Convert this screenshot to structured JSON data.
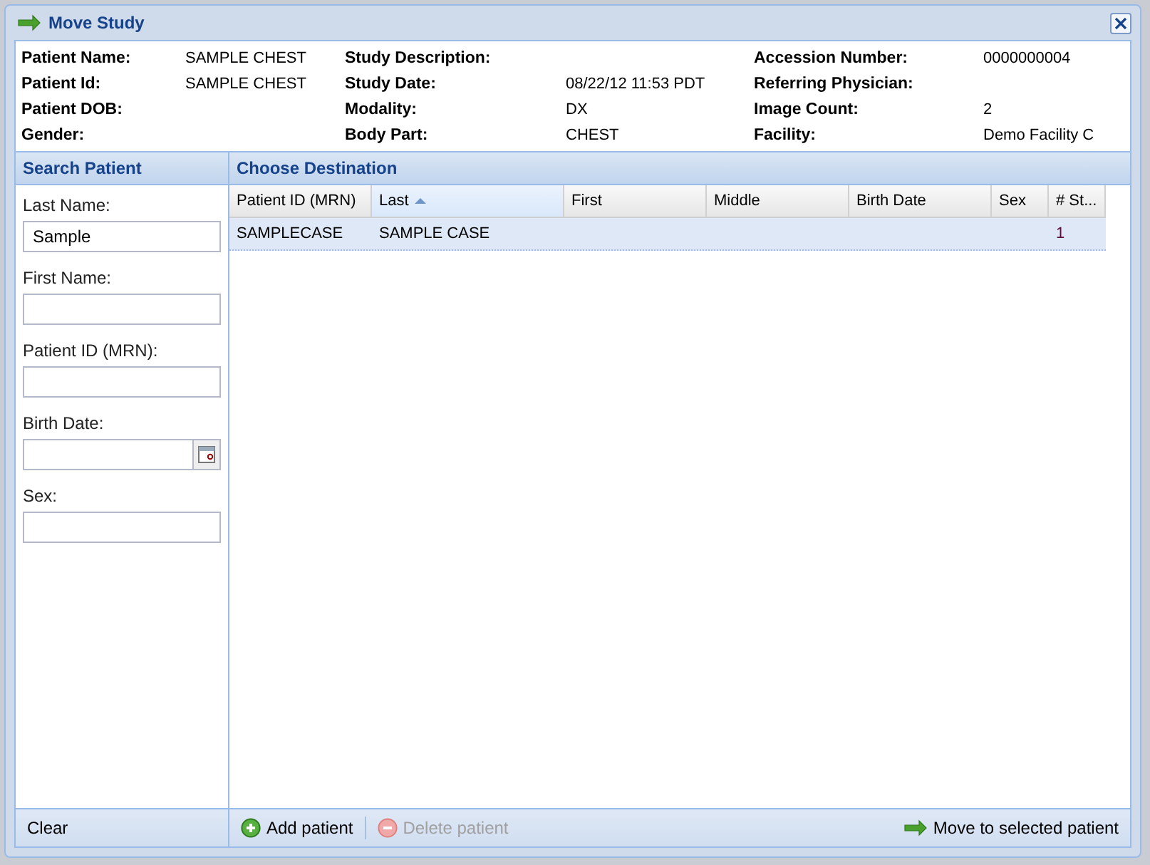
{
  "window": {
    "title": "Move Study"
  },
  "study_info": [
    {
      "items": [
        {
          "label": "Patient Name:",
          "value": "SAMPLE CHEST"
        },
        {
          "label": "Patient Id:",
          "value": "SAMPLE CHEST"
        },
        {
          "label": "Patient DOB:"
        },
        {
          "label": "Gender:"
        }
      ]
    },
    {
      "items": [
        {
          "label": "Study Description:"
        },
        {
          "label": "Study Date:",
          "value": "08/22/12 11:53 PDT"
        },
        {
          "label": "Modality:",
          "value": "DX"
        },
        {
          "label": "Body Part:",
          "value": "CHEST"
        }
      ]
    },
    {
      "items": [
        {
          "label": "Accession Number:",
          "value": "0000000004"
        },
        {
          "label": "Referring Physician:"
        },
        {
          "label": "Image Count:",
          "value": "2"
        },
        {
          "label": "Facility:",
          "value": "Demo Facility C"
        }
      ]
    }
  ],
  "search_panel": {
    "title": "Search Patient",
    "fields": [
      {
        "label": "Last Name:",
        "kind": "text",
        "value": "Sample"
      },
      {
        "label": "First Name:",
        "kind": "text"
      },
      {
        "label": "Patient ID (MRN):",
        "kind": "text"
      },
      {
        "label": "Birth Date:",
        "kind": "date"
      },
      {
        "label": "Sex:",
        "kind": "text"
      }
    ],
    "clear_button": "Clear"
  },
  "destination_panel": {
    "title": "Choose Destination",
    "table": {
      "columns": [
        {
          "label": "Patient ID (MRN)",
          "sorted": false
        },
        {
          "label": "Last",
          "sorted": true
        },
        {
          "label": "First",
          "sorted": false
        },
        {
          "label": "Middle",
          "sorted": false
        },
        {
          "label": "Birth Date",
          "sorted": false
        },
        {
          "label": "Sex",
          "sorted": false
        },
        {
          "label": "# St...",
          "sorted": false
        }
      ],
      "rows": [
        {
          "cells": [
            "SAMPLECASE",
            "SAMPLE CASE",
            null,
            null,
            null,
            null,
            "1"
          ],
          "selected": true
        }
      ]
    },
    "toolbar": {
      "add_button": {
        "label": "Add patient",
        "disabled": false
      },
      "delete_button": {
        "label": "Delete patient",
        "disabled": true
      },
      "move_button": {
        "label": "Move to selected patient",
        "disabled": false
      }
    }
  }
}
